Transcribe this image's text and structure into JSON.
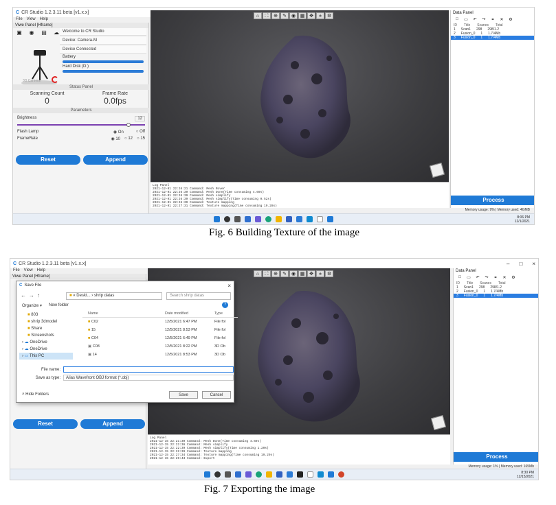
{
  "figure1": {
    "window_title": "CR Studio 1.2.3.11 beta [v1.x.x]",
    "menu": [
      "File",
      "View",
      "Help"
    ],
    "left_panel": {
      "title": "Viwe Panel [Hframe]",
      "welcome": "Welcome to CR Studio",
      "device": "Device: Camera-M",
      "status": "Device Connected",
      "battery_label": "Battery",
      "hard_disk_label": "Hard Disk (D:)",
      "camera_label": "3D Camera",
      "status_panel": "Status Panel",
      "scanning_count_label": "Scanning Count",
      "scanning_count": "0",
      "frame_rate_label": "Frame Rate",
      "frame_rate": "0.0fps",
      "parameters_label": "Parameters",
      "brightness_label": "Brightness",
      "brightness_value": "12",
      "brightness_level": 0.9,
      "flash_lamp_label": "Flash Lamp",
      "flash_on": "On",
      "flash_off": "Off",
      "frame_rate_opt_label": "FrameRate",
      "frame_rate_opts": [
        "10",
        "12",
        "15"
      ],
      "reset": "Reset",
      "append": "Append"
    },
    "log": [
      "Log Panel",
      "2021-12-01 22:26:21 Command: Mesh Rover",
      "2021-12-01 22:26:39 Command: Mesh Done(Time consuming 4.69s)",
      "2021-12-01 22:26:39 Command: Mesh simplify",
      "2021-12-01 22:26:39 Command: Mesh simplify(Time consuming 0.52s)",
      "2021-12-01 22:26:39 Command: Texture mapping",
      "2021-12-01 22:27:31 Command: Texture mapping(Time consuming 19.28s)"
    ],
    "data_panel": {
      "title": "Data Panel",
      "headers": [
        "ID",
        "Title",
        "Scanes",
        "Total"
      ],
      "rows": [
        {
          "id": "1",
          "title": "Scan1",
          "scans": "298",
          "total": "298/1.2"
        },
        {
          "id": "2",
          "title": "Fusion_0",
          "scans": "1",
          "total": "1.7/4Mb"
        },
        {
          "id": "3",
          "title": "Fusion_0",
          "scans": "1",
          "total": "1.7/4Mb"
        }
      ]
    },
    "process": "Process",
    "memory": "Memory usage: 9% | Memory used: 4GMB",
    "clock": [
      "8:06 PM",
      "12/1/2021"
    ],
    "caption": "Fig. 6   Building Texture of  the image"
  },
  "figure2": {
    "window_title": "CR Studio 1.2.3.11 beta [v1.x.x]",
    "menu": [
      "File",
      "View",
      "Help"
    ],
    "panel_title": "Viwe Panel [Hframe]",
    "dialog": {
      "title": "Save File",
      "address": "« Deskt... › shrip datas",
      "search_placeholder": "Search shrip datas",
      "organize": "Organize ▾",
      "new_folder": "New folder",
      "nav": [
        "803",
        "shrip 3dmodel",
        "Share",
        "Screenshots",
        "OneDrive",
        "OneDrive",
        "This PC"
      ],
      "columns": [
        "Name",
        "Date modified",
        "Type"
      ],
      "files": [
        {
          "name": "C02",
          "date": "12/5/2021 6:47 PM",
          "type": "File fol"
        },
        {
          "name": "15",
          "date": "12/5/2021 8:53 PM",
          "type": "File fol"
        },
        {
          "name": "C04",
          "date": "12/5/2021 6:49 PM",
          "type": "File fol"
        },
        {
          "name": "C08",
          "date": "12/5/2021 8:22 PM",
          "type": "3D Ob"
        },
        {
          "name": "14",
          "date": "12/5/2021 8:53 PM",
          "type": "3D Ob"
        }
      ],
      "file_name_label": "File name:",
      "file_name_value": "",
      "save_type_label": "Save as type:",
      "save_type_value": "Alias Wavefront OBJ format (*.obj)",
      "hide_folders": "Hide Folders",
      "save": "Save",
      "cancel": "Cancel"
    },
    "reset": "Reset",
    "append": "Append",
    "log": [
      "Log Panel",
      "2021-12-15 22:21:30 Command: Mesh Done(Time consuming 4.69s)",
      "2021-12-15 22:22:36 Command: Mesh simplify",
      "2021-12-15 22:22:39 Command: Mesh simplify(Time consuming 1.20s)",
      "2021-12-15 22:22:39 Command: Texture mapping",
      "2021-12-15 22:27:34 Command: Texture mapping(Time consuming 19.29s)",
      "2021-12-15 22:29:43 Command: Export"
    ],
    "data_panel": {
      "title": "Data Panel",
      "headers": [
        "ID",
        "Title",
        "Scanes",
        "Total"
      ],
      "rows": [
        {
          "id": "1",
          "title": "Scan1",
          "scans": "298",
          "total": "298/1.2"
        },
        {
          "id": "2",
          "title": "Fusion_0",
          "scans": "1",
          "total": "1.7/4Mb"
        },
        {
          "id": "3",
          "title": "Fusion_0",
          "scans": "1",
          "total": "1.7/4Mb"
        }
      ]
    },
    "process": "Process",
    "memory": "Memory usage: 1% | Memory used: 165Mb",
    "clock": [
      "8:30 PM",
      "12/15/2021"
    ],
    "caption": "Fig. 7    Exporting the image"
  },
  "colors": {
    "accent": "#1f7ad6",
    "selection": "#2a7de1",
    "viewport": "#3d3d40",
    "rock": "#4a4560"
  }
}
